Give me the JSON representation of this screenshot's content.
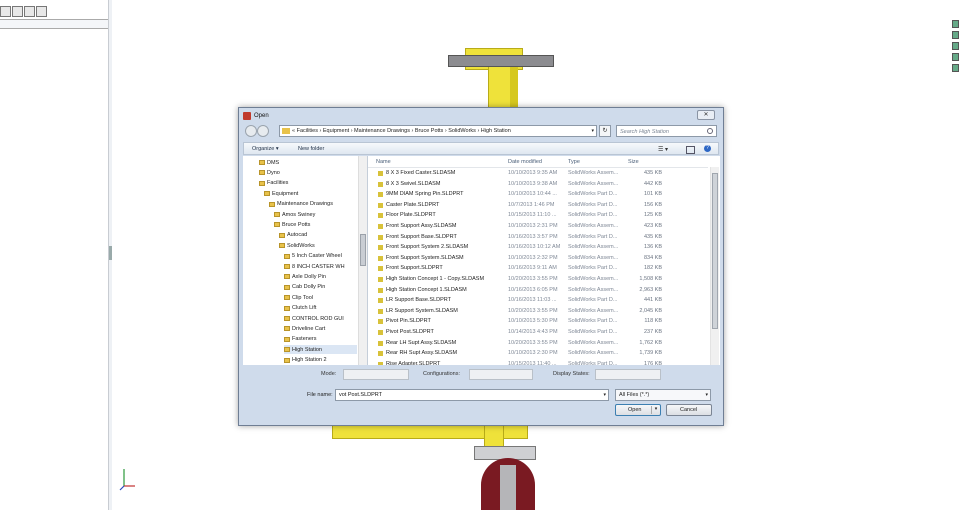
{
  "dialog": {
    "title": "Open",
    "close_label": "✕",
    "address_path": "« Facilities › Equipment › Maintenance Drawings › Bruce Potts › SolidWorks › High Station",
    "search_placeholder": "Search High Station",
    "organize_label": "Organize ▾",
    "new_folder_label": "New folder"
  },
  "nav_tree": [
    {
      "label": "DMS",
      "indent": 1
    },
    {
      "label": "Dyno",
      "indent": 1
    },
    {
      "label": "Facilities",
      "indent": 1
    },
    {
      "label": "Equipment",
      "indent": 2
    },
    {
      "label": "Maintenance Drawings",
      "indent": 3
    },
    {
      "label": "Amos Swiney",
      "indent": 4
    },
    {
      "label": "Bruce Potts",
      "indent": 4
    },
    {
      "label": "Autocad",
      "indent": 5
    },
    {
      "label": "SolidWorks",
      "indent": 5
    },
    {
      "label": "5 Inch Caster Wheel",
      "indent": 6
    },
    {
      "label": "8 INCH CASTER WH",
      "indent": 6
    },
    {
      "label": "Axle Dolly Pin",
      "indent": 6
    },
    {
      "label": "Cab Dolly Pin",
      "indent": 6
    },
    {
      "label": "Clip Tool",
      "indent": 6
    },
    {
      "label": "Clutch Lift",
      "indent": 6
    },
    {
      "label": "CONTROL ROD GUI",
      "indent": 6
    },
    {
      "label": "Driveline Cart",
      "indent": 6
    },
    {
      "label": "Fasteners",
      "indent": 6
    },
    {
      "label": "High Station",
      "indent": 6,
      "selected": true
    },
    {
      "label": "High Station 2",
      "indent": 6
    }
  ],
  "columns": {
    "name": "Name",
    "date": "Date modified",
    "type": "Type",
    "size": "Size"
  },
  "files": [
    {
      "name": "8 X 3 Fixed Caster.SLDASM",
      "date": "10/10/2013 9:35 AM",
      "type": "SolidWorks Assem...",
      "size": "435 KB"
    },
    {
      "name": "8 X 3 Swivel.SLDASM",
      "date": "10/10/2013 9:38 AM",
      "type": "SolidWorks Assem...",
      "size": "442 KB"
    },
    {
      "name": "9MM DIAM Spring Pin.SLDPRT",
      "date": "10/10/2013 10:44 ...",
      "type": "SolidWorks Part D...",
      "size": "101 KB"
    },
    {
      "name": "Caster Plate.SLDPRT",
      "date": "10/7/2013 1:46 PM",
      "type": "SolidWorks Part D...",
      "size": "156 KB"
    },
    {
      "name": "Floor Plate.SLDPRT",
      "date": "10/15/2013 11:10 ...",
      "type": "SolidWorks Part D...",
      "size": "125 KB"
    },
    {
      "name": "Front Support Assy.SLDASM",
      "date": "10/10/2013 2:31 PM",
      "type": "SolidWorks Assem...",
      "size": "423 KB"
    },
    {
      "name": "Front Support Base.SLDPRT",
      "date": "10/16/2013 3:57 PM",
      "type": "SolidWorks Part D...",
      "size": "435 KB"
    },
    {
      "name": "Front Support System 2.SLDASM",
      "date": "10/16/2013 10:12 AM",
      "type": "SolidWorks Assem...",
      "size": "136 KB"
    },
    {
      "name": "Front Support System.SLDASM",
      "date": "10/10/2013 2:32 PM",
      "type": "SolidWorks Assem...",
      "size": "834 KB"
    },
    {
      "name": "Front Support.SLDPRT",
      "date": "10/16/2013 9:11 AM",
      "type": "SolidWorks Part D...",
      "size": "182 KB"
    },
    {
      "name": "High Station Concept 1 - Copy.SLDASM",
      "date": "10/20/2013 3:55 PM",
      "type": "SolidWorks Assem...",
      "size": "1,508 KB"
    },
    {
      "name": "High Station Concept 1.SLDASM",
      "date": "10/16/2013 6:05 PM",
      "type": "SolidWorks Assem...",
      "size": "2,963 KB"
    },
    {
      "name": "LR Support Base.SLDPRT",
      "date": "10/16/2013 11:03 ...",
      "type": "SolidWorks Part D...",
      "size": "441 KB"
    },
    {
      "name": "LR Support System.SLDASM",
      "date": "10/20/2013 3:55 PM",
      "type": "SolidWorks Assem...",
      "size": "2,045 KB"
    },
    {
      "name": "Pivot Pin.SLDPRT",
      "date": "10/10/2013 5:30 PM",
      "type": "SolidWorks Part D...",
      "size": "118 KB"
    },
    {
      "name": "Pivot Post.SLDPRT",
      "date": "10/14/2013 4:43 PM",
      "type": "SolidWorks Part D...",
      "size": "237 KB"
    },
    {
      "name": "Rear LH Supt Assy.SLDASM",
      "date": "10/20/2013 3:55 PM",
      "type": "SolidWorks Assem...",
      "size": "1,762 KB"
    },
    {
      "name": "Rear RH Supt Assy.SLDASM",
      "date": "10/10/2013 2:30 PM",
      "type": "SolidWorks Assem...",
      "size": "1,739 KB"
    },
    {
      "name": "Rise Adapter.SLDPRT",
      "date": "10/15/2013 11:40 ...",
      "type": "SolidWorks Part D...",
      "size": "176 KB"
    }
  ],
  "options": {
    "mode_label": "Mode:",
    "configurations_label": "Configurations:",
    "display_states_label": "Display States:"
  },
  "filename": {
    "label": "File name:",
    "value": "vot Post.SLDPRT"
  },
  "filetype": {
    "value": "All Files (*.*)"
  },
  "buttons": {
    "open": "Open",
    "cancel": "Cancel"
  },
  "colors": {
    "accent": "#3c7fb1",
    "part_yellow": "#efe23a",
    "wheel_red": "#7a1a22"
  }
}
